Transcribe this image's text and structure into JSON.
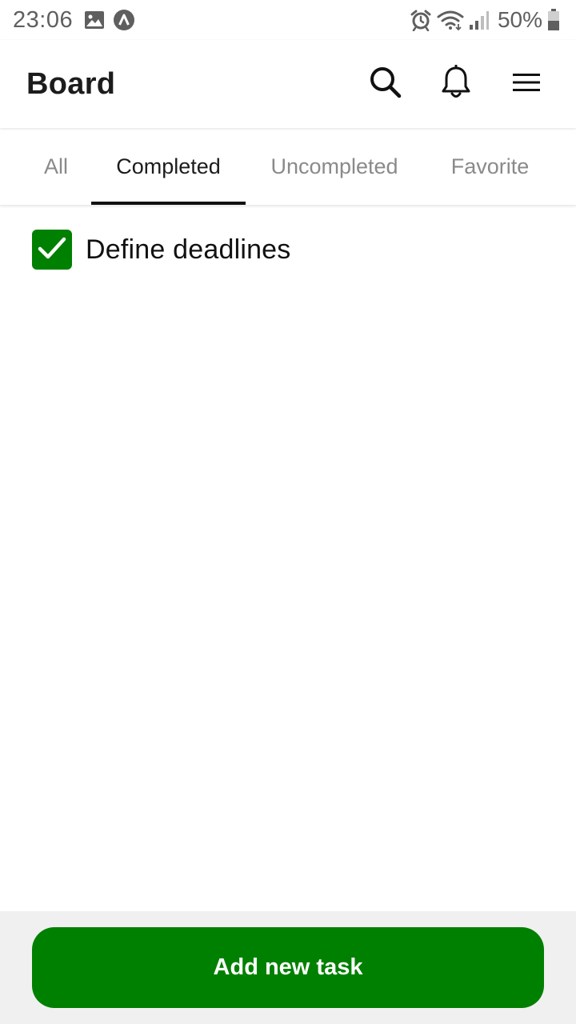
{
  "status_bar": {
    "time": "23:06",
    "battery": "50%",
    "icons": [
      "gallery-icon",
      "app-a-icon",
      "alarm-icon",
      "wifi-icon",
      "signal-icon",
      "battery-icon"
    ],
    "color": "#5f5f5f"
  },
  "app_bar": {
    "title": "Board",
    "actions": [
      "search-icon",
      "bell-icon",
      "menu-icon"
    ]
  },
  "tabs": [
    {
      "label": "All",
      "active": false
    },
    {
      "label": "Completed",
      "active": true
    },
    {
      "label": "Uncompleted",
      "active": false
    },
    {
      "label": "Favorite",
      "active": false
    }
  ],
  "tasks": [
    {
      "label": "Define deadlines",
      "checked": true
    }
  ],
  "footer": {
    "add_button_label": "Add new task"
  },
  "colors": {
    "accent": "#008000",
    "bottom_bar_bg": "#f0f0f0",
    "tab_active_text": "#1c1c1c",
    "tab_inactive_text": "#8a8a8a"
  }
}
